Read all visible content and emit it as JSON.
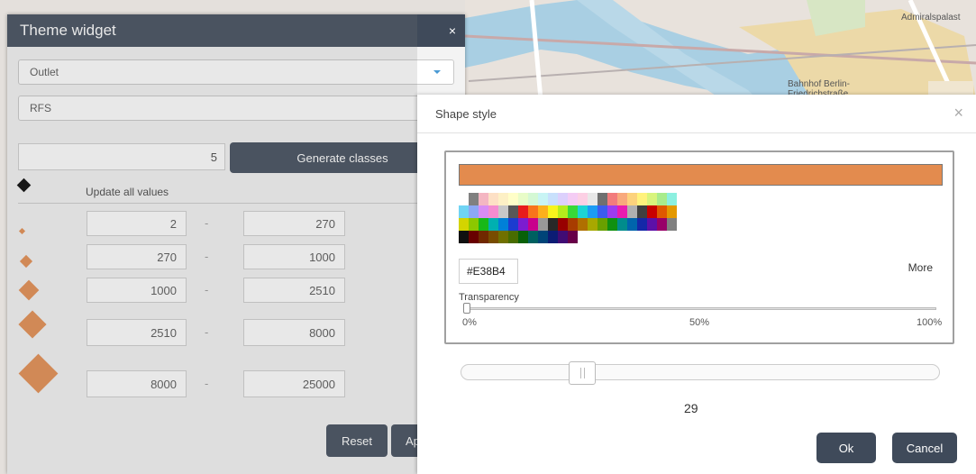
{
  "map": {
    "labels": {
      "admiralspalast": "Admiralspalast",
      "bahnhof": "Bahnhof Berlin-",
      "friedrich": "Friedrichstraße"
    }
  },
  "theme_widget": {
    "title": "Theme widget",
    "close_icon": "×",
    "field_select": "Outlet",
    "attribute_select": "RFS",
    "class_count": "5",
    "generate_label": "Generate classes",
    "update_all_label": "Update all values",
    "classes": [
      {
        "from": "2",
        "to": "270"
      },
      {
        "from": "270",
        "to": "1000"
      },
      {
        "from": "1000",
        "to": "2510"
      },
      {
        "from": "2510",
        "to": "8000"
      },
      {
        "from": "8000",
        "to": "25000"
      }
    ],
    "dash": "-",
    "reset_label": "Reset",
    "apply_label": "Ap",
    "symbol_color": "#E38B4E"
  },
  "shape_style": {
    "title": "Shape style",
    "close_icon": "×",
    "selected_color": "#E38B4E",
    "hex_value": "#E38B4",
    "more_label": "More",
    "transparency_label": "Transparency",
    "transparency_ticks": [
      "0%",
      "50%",
      "100%"
    ],
    "transparency_value": 0,
    "size_value": "29",
    "ok_label": "Ok",
    "cancel_label": "Cancel",
    "palette": [
      [
        "#ffffff",
        "#808080",
        "#f4b6c2",
        "#fde0c5",
        "#fdf0c5",
        "#fffec8",
        "#e8fcc8",
        "#d4f8d4",
        "#c8f4f4",
        "#c8e0fc",
        "#dcd0fc",
        "#f4ccf4",
        "#fcd0e4",
        "#e8e8e8",
        "#707070",
        "#f27c7c",
        "#f8a97c",
        "#fcd27c",
        "#fff27c",
        "#d8f47c",
        "#a8ec8c",
        "#8cf0e0"
      ],
      [
        "#70d4f4",
        "#8ca8f4",
        "#d88cf4",
        "#f48cd0",
        "#c8c8c8",
        "#585858",
        "#e81c1c",
        "#f8741c",
        "#fcb01c",
        "#f8f41c",
        "#b4ec1c",
        "#38d838",
        "#1cd4d4",
        "#1c9cf4",
        "#3c5cf0",
        "#9c3cf0",
        "#e81cb0",
        "#b0b0b0",
        "#404040",
        "#c80000",
        "#e05800",
        "#e49800"
      ],
      [
        "#d4d400",
        "#8cc800",
        "#18b818",
        "#00b0b0",
        "#0080d8",
        "#1c3cd0",
        "#7c1cd0",
        "#c8008c",
        "#989898",
        "#282828",
        "#980000",
        "#a83c00",
        "#b07000",
        "#a8a800",
        "#68a000",
        "#109010",
        "#008c8c",
        "#0064ac",
        "#1428a8",
        "#5c10a8",
        "#980068",
        "#808080"
      ],
      [
        "#101010",
        "#680000",
        "#702800",
        "#784c00",
        "#707000",
        "#486c00",
        "#086008",
        "#006060",
        "#004478",
        "#0c1c74",
        "#400c74",
        "#680048"
      ]
    ]
  }
}
